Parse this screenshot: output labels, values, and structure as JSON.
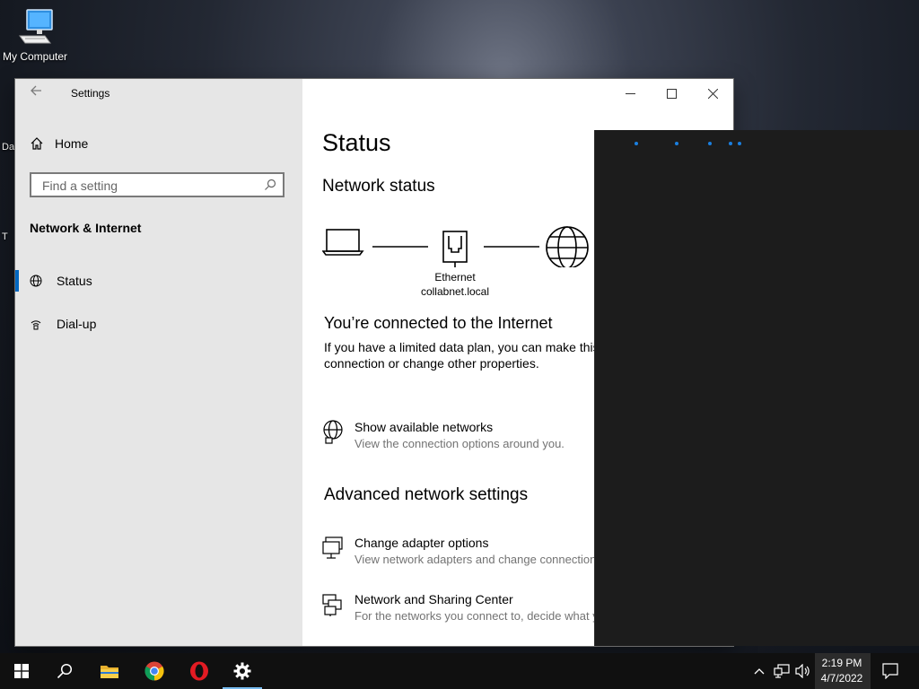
{
  "desktop": {
    "icon_label": "My Computer",
    "clipped_labels": [
      "Da",
      "T"
    ]
  },
  "window": {
    "title": "Settings",
    "nav": {
      "home_label": "Home",
      "search_placeholder": "Find a setting",
      "section_title": "Network & Internet",
      "items": [
        {
          "label": "Status",
          "icon": "globe-icon",
          "active": true
        },
        {
          "label": "Dial-up",
          "icon": "dialup-icon",
          "active": false
        }
      ]
    },
    "content": {
      "page_title": "Status",
      "network_status_heading": "Network status",
      "diagram": {
        "adapter_name": "Ethernet",
        "network_name": "collabnet.local"
      },
      "connected_heading": "You’re connected to the Internet",
      "connected_desc": "If you have a limited data plan, you can make this network a metered connection or change other properties.",
      "show_networks": {
        "title": "Show available networks",
        "subtitle": "View the connection options around you."
      },
      "advanced_heading": "Advanced network settings",
      "change_adapter": {
        "title": "Change adapter options",
        "subtitle": "View network adapters and change connection settings."
      },
      "sharing_center": {
        "title": "Network and Sharing Center",
        "subtitle": "For the networks you connect to, decide what you want to share."
      }
    }
  },
  "taskbar": {
    "apps": [
      "start",
      "search",
      "file-explorer",
      "chrome",
      "opera",
      "settings"
    ],
    "active_app": "settings",
    "clock": {
      "time": "2:19 PM",
      "date": "4/7/2022"
    }
  },
  "colors": {
    "accent": "#0067c0",
    "taskbar_active": "#76b9ed",
    "dot_blue": "#1a7fe0"
  }
}
